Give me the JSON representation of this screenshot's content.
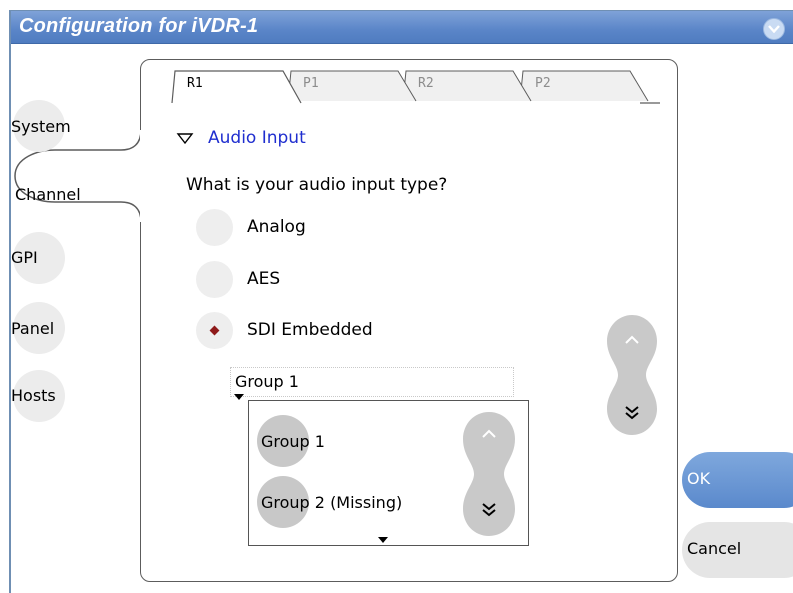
{
  "window": {
    "title": "Configuration for iVDR-1",
    "menu_icon": "chevron-down-icon"
  },
  "nav": {
    "items": [
      {
        "label": "System",
        "active": false
      },
      {
        "label": "Channel",
        "active": true
      },
      {
        "label": "GPI",
        "active": false
      },
      {
        "label": "Panel",
        "active": false
      },
      {
        "label": "Hosts",
        "active": false
      }
    ]
  },
  "tabs": [
    {
      "label": "R1",
      "active": true
    },
    {
      "label": "P1",
      "active": false
    },
    {
      "label": "R2",
      "active": false
    },
    {
      "label": "P2",
      "active": false
    }
  ],
  "section": {
    "label": "Audio Input",
    "expanded": true
  },
  "question": "What is your audio input type?",
  "audio_types": [
    {
      "label": "Analog",
      "selected": false
    },
    {
      "label": "AES",
      "selected": false
    },
    {
      "label": "SDI Embedded",
      "selected": true
    }
  ],
  "group_select": {
    "value": "Group 1"
  },
  "group_list": [
    {
      "label": "Group 1"
    },
    {
      "label": "Group 2 (Missing)"
    }
  ],
  "buttons": {
    "ok": "OK",
    "cancel": "Cancel"
  },
  "colors": {
    "titlebar": "#5a85c8",
    "accent_text": "#1f2ecf",
    "radio_selected": "#8e1a1a",
    "ok_button": "#6a97d4"
  }
}
